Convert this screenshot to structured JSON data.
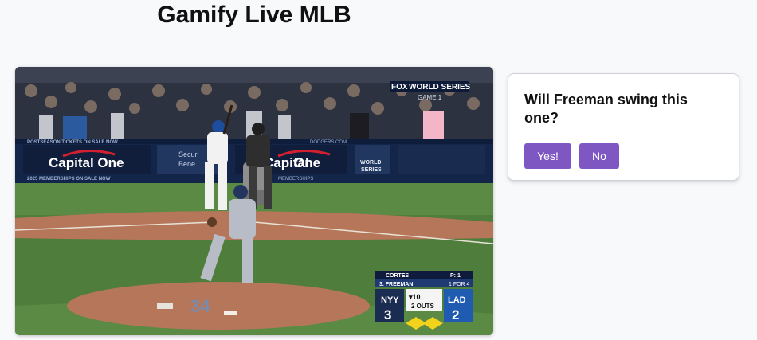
{
  "app": {
    "title": "Gamify Live MLB"
  },
  "video": {
    "broadcast": {
      "network": "FOX",
      "series": "WORLD SERIES",
      "game": "GAME 1"
    },
    "banners": {
      "postseason_tickets": "POSTSEASON TICKETS ON SALE NOW",
      "memberships": "2025 MEMBERSHIPS ON SALE NOW",
      "sponsor": "Capital One",
      "sponsor_partial": "Capital",
      "sponsor_partial_2": "One",
      "securian_line1": "Securi",
      "securian_line2": "Bene",
      "ws_line1": "WORLD",
      "ws_line2": "SERIES",
      "dodgers_url": "DODGERS.COM",
      "membership_tail": "MEMBERSHIPS"
    },
    "mound_number": "34",
    "scorebug": {
      "pitcher": "CORTES",
      "pitch_count": "P: 1",
      "batter": "3. FREEMAN",
      "batter_stat": "1 FOR 4",
      "away_team": "NYY",
      "away_score": "3",
      "home_team": "LAD",
      "home_score": "2",
      "inning": "▾10",
      "outs": "2 OUTS"
    }
  },
  "prediction": {
    "question": "Will Freeman swing this one?",
    "yes_label": "Yes!",
    "no_label": "No"
  },
  "colors": {
    "accent": "#7e57c2",
    "dodger_blue": "#1d3d6e",
    "field_green": "#4f7d3b",
    "dirt": "#b5765a"
  }
}
